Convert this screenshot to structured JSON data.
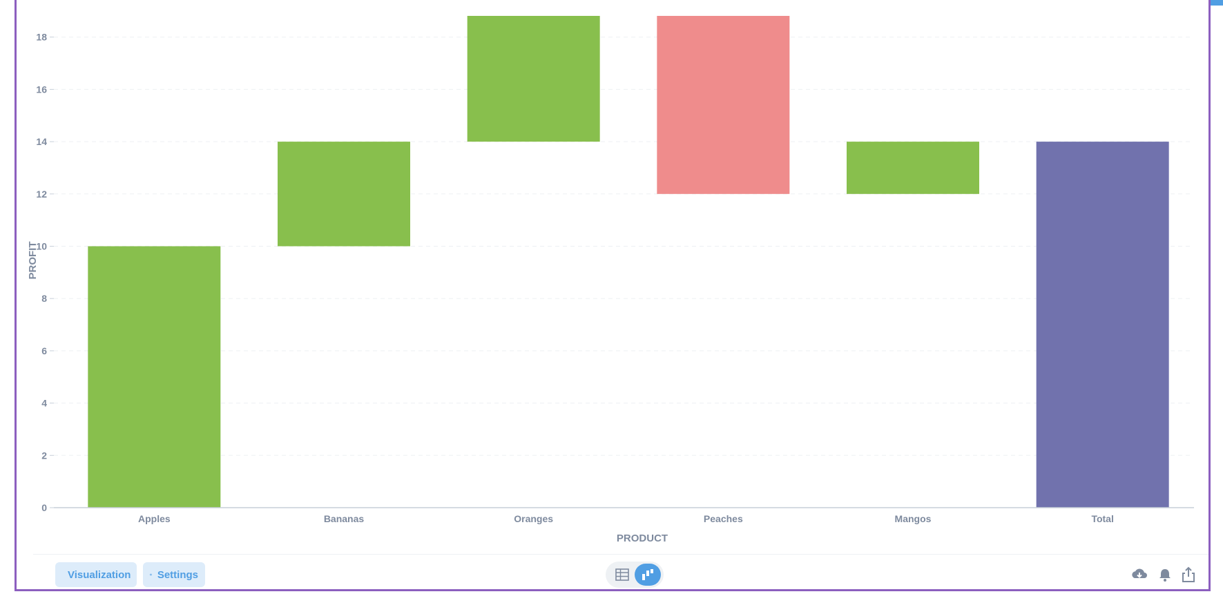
{
  "chart_data": {
    "type": "waterfall",
    "categories": [
      "Apples",
      "Bananas",
      "Oranges",
      "Peaches",
      "Mangos",
      "Total"
    ],
    "values": [
      10,
      4,
      5,
      -7,
      2,
      14
    ],
    "total_label": "Total",
    "xlabel": "PRODUCT",
    "ylabel": "PROFIT",
    "ylim": [
      0,
      19
    ],
    "yticks": [
      0,
      2,
      4,
      6,
      8,
      10,
      12,
      14,
      16,
      18
    ],
    "grid": true,
    "colors": {
      "increase": "#88bf4d",
      "decrease": "#ef8c8c",
      "total": "#7172ad"
    }
  },
  "footer": {
    "visualization_label": "Visualization",
    "settings_label": "Settings",
    "icons": [
      "visualization-icon",
      "gear-icon",
      "table-icon",
      "chart-icon",
      "download-icon",
      "bell-icon",
      "share-icon"
    ]
  }
}
